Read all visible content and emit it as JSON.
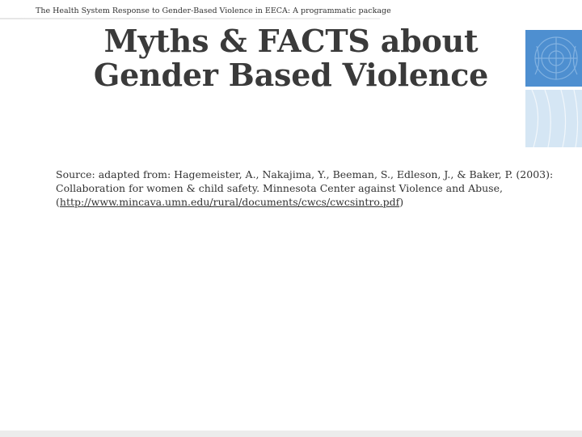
{
  "header": {
    "text": "The Health System Response to Gender-Based Violence in EECA: A programmatic package"
  },
  "title": {
    "line1": "Myths & FACTS about",
    "line2": "Gender Based Violence"
  },
  "source": {
    "line1": "Source: adapted from: Hagemeister, A., Nakajima, Y., Beeman, S., Edleson, J., & Baker, P. (2003):",
    "line2": "Collaboration for women & child safety. Minnesota Center against Violence and Abuse,",
    "paren_open": "(",
    "link": "http://www.mincava.umn.edu/rural/documents/cwcs/cwcsintro.pdf",
    "paren_close": ")"
  },
  "logo": {
    "name": "un-emblem-panel",
    "colors": {
      "top": "#4e8fd0",
      "bottom": "#d5e6f4"
    }
  }
}
